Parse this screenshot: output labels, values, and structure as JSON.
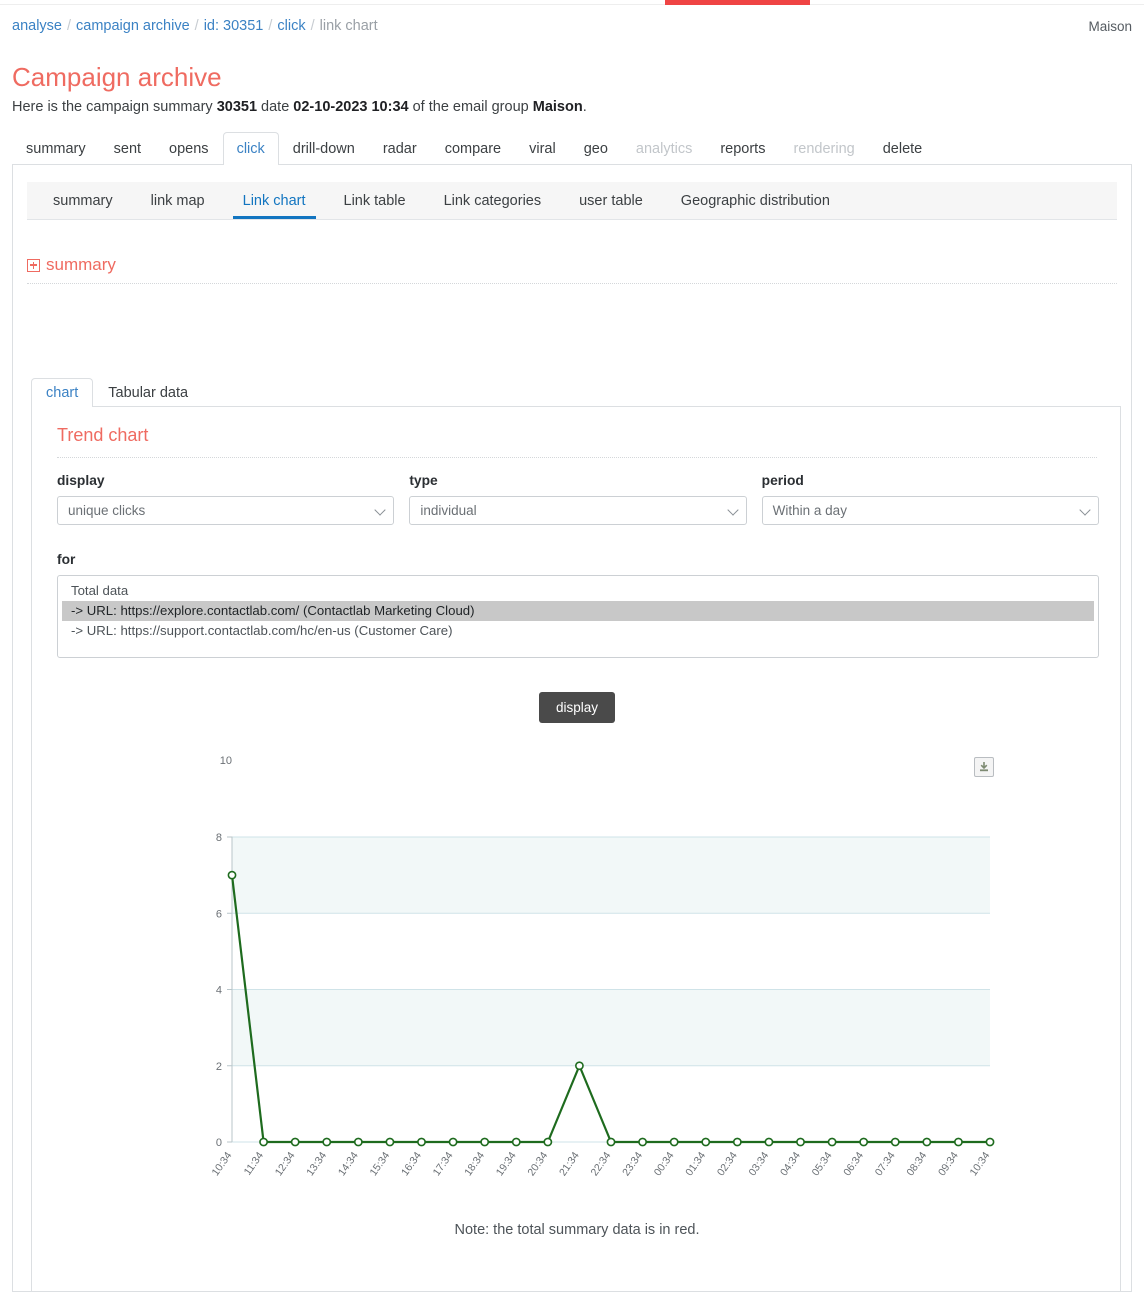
{
  "breadcrumb": {
    "items": [
      {
        "label": "analyse",
        "type": "link"
      },
      {
        "label": "campaign archive",
        "type": "link"
      },
      {
        "label": "id: 30351",
        "type": "link"
      },
      {
        "label": "click",
        "type": "link"
      },
      {
        "label": "link chart",
        "type": "current"
      }
    ],
    "separator": "/"
  },
  "user": {
    "label": "Maison"
  },
  "header": {
    "title": "Campaign archive",
    "summary_prefix": "Here is the campaign summary ",
    "campaign_id": "30351",
    "date_word": " date ",
    "date": "02-10-2023 10:34",
    "group_word": " of the email group ",
    "group": "Maison",
    "period_end": "."
  },
  "main_tabs": [
    {
      "label": "summary",
      "state": "normal"
    },
    {
      "label": "sent",
      "state": "normal"
    },
    {
      "label": "opens",
      "state": "normal"
    },
    {
      "label": "click",
      "state": "active"
    },
    {
      "label": "drill-down",
      "state": "normal"
    },
    {
      "label": "radar",
      "state": "normal"
    },
    {
      "label": "compare",
      "state": "normal"
    },
    {
      "label": "viral",
      "state": "normal"
    },
    {
      "label": "geo",
      "state": "normal"
    },
    {
      "label": "analytics",
      "state": "disabled"
    },
    {
      "label": "reports",
      "state": "normal"
    },
    {
      "label": "rendering",
      "state": "disabled"
    },
    {
      "label": "delete",
      "state": "normal"
    }
  ],
  "sub_tabs": [
    {
      "label": "summary",
      "state": "normal"
    },
    {
      "label": "link map",
      "state": "normal"
    },
    {
      "label": "Link chart",
      "state": "active"
    },
    {
      "label": "Link table",
      "state": "normal"
    },
    {
      "label": "Link categories",
      "state": "normal"
    },
    {
      "label": "user table",
      "state": "normal"
    },
    {
      "label": "Geographic distribution",
      "state": "normal"
    }
  ],
  "summary_accordion": {
    "label": "summary",
    "icon": "plus-box-icon",
    "expanded": false
  },
  "card_tabs": [
    {
      "label": "chart",
      "state": "active"
    },
    {
      "label": "Tabular data",
      "state": "normal"
    }
  ],
  "trend": {
    "title": "Trend chart",
    "fields": {
      "display": {
        "label": "display",
        "value": "unique clicks"
      },
      "type": {
        "label": "type",
        "value": "individual"
      },
      "period": {
        "label": "period",
        "value": "Within a day"
      }
    },
    "for": {
      "label": "for",
      "options": [
        {
          "label": "Total data",
          "selected": false
        },
        {
          "label": "-> URL: https://explore.contactlab.com/ (Contactlab Marketing Cloud)",
          "selected": true
        },
        {
          "label": "-> URL: https://support.contactlab.com/hc/en-us (Customer Care)",
          "selected": false
        }
      ]
    },
    "display_button": "display",
    "export_icon": "download-icon",
    "note": "Note: the total summary data is in red."
  },
  "colors": {
    "accent_red": "#ef6b61",
    "link_blue": "#3b82c4",
    "active_tab_blue": "#1275c0",
    "series_green": "#1e6b1e",
    "band_fill": "#f2f8f8",
    "gridline": "#cfe3e8",
    "topbar_accent": "#ef4444"
  },
  "chart_data": {
    "type": "line",
    "title": "Trend chart",
    "xlabel": "",
    "ylabel": "",
    "ylim": [
      0,
      10
    ],
    "yticks": [
      0,
      2,
      4,
      6,
      8,
      10
    ],
    "grid": true,
    "legend": "none",
    "series": [
      {
        "name": "-> URL: https://explore.contactlab.com/ (Contactlab Marketing Cloud)",
        "color": "#1e6b1e",
        "values": [
          7,
          0,
          0,
          0,
          0,
          0,
          0,
          0,
          0,
          0,
          0,
          2,
          0,
          0,
          0,
          0,
          0,
          0,
          0,
          0,
          0,
          0,
          0,
          0,
          0
        ]
      }
    ],
    "categories": [
      "10:34",
      "11:34",
      "12:34",
      "13:34",
      "14:34",
      "15:34",
      "16:34",
      "17:34",
      "18:34",
      "19:34",
      "20:34",
      "21:34",
      "22:34",
      "23:34",
      "00:34",
      "01:34",
      "02:34",
      "03:34",
      "04:34",
      "05:34",
      "06:34",
      "07:34",
      "08:34",
      "09:34",
      "10:34"
    ],
    "shaded_bands": [
      [
        2,
        4
      ],
      [
        6,
        8
      ]
    ],
    "note": "Note: the total summary data is in red."
  }
}
